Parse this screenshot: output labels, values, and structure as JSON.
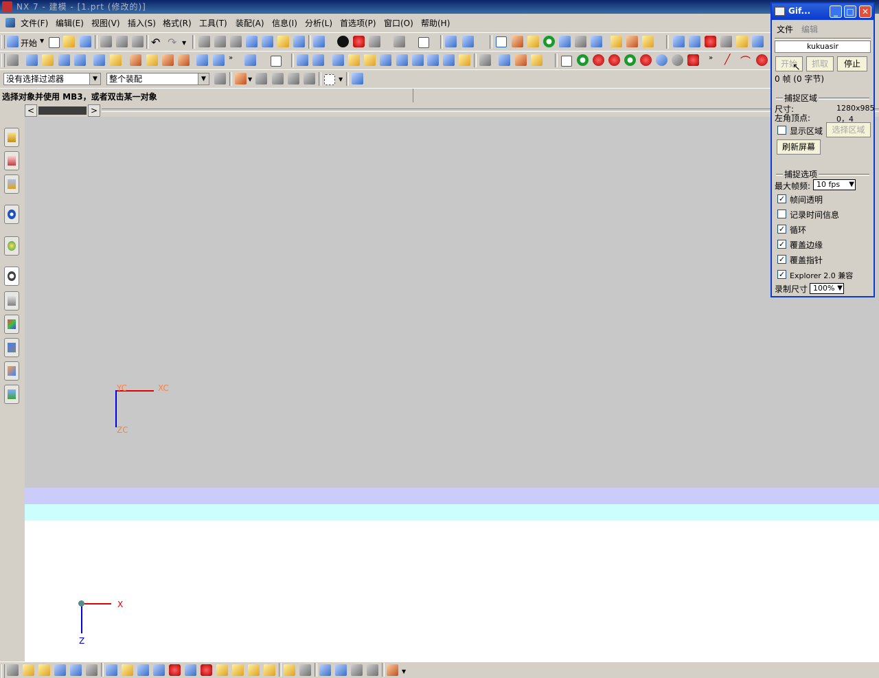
{
  "app": {
    "title": "NX 7 - 建模 - [1.prt (修改的)]"
  },
  "menu": {
    "items": [
      {
        "label": "开始"
      },
      {
        "label": "文件(F)"
      },
      {
        "label": "编辑(E)"
      },
      {
        "label": "视图(V)"
      },
      {
        "label": "插入(S)"
      },
      {
        "label": "格式(R)"
      },
      {
        "label": "工具(T)"
      },
      {
        "label": "装配(A)"
      },
      {
        "label": "信息(I)"
      },
      {
        "label": "分析(L)"
      },
      {
        "label": "首选项(P)"
      },
      {
        "label": "窗口(O)"
      },
      {
        "label": "帮助(H)"
      }
    ]
  },
  "toolbar": {
    "start_label": "开始",
    "filter_value": "没有选择过滤器",
    "scope_value": "整个装配"
  },
  "status": {
    "prompt": "选择对象并使用 MB3，或者双击某一对象"
  },
  "scroll": {
    "left_arrow": "<",
    "right_arrow": ">"
  },
  "axes": {
    "wcs": {
      "x": "XC",
      "y": "YC",
      "z": "ZC"
    },
    "abs": {
      "x": "X",
      "z": "Z"
    }
  },
  "gif": {
    "title": "Gif...",
    "menu_file": "文件",
    "menu_edit": "编辑",
    "author": "kukuasir",
    "start": "开始",
    "grab": "抓取",
    "stop": "停止",
    "frames": "0 帧 (0 字节)",
    "capture_area": "捕捉区域",
    "size_label": "尺寸:",
    "size_value": "1280x985",
    "corner_label": "左角顶点:",
    "corner_value": "0，4",
    "show_area": "显示区域",
    "select_area": "选择区域",
    "refresh": "刷新屏幕",
    "capture_options": "捕捉选项",
    "max_fps_label": "最大帧频:",
    "max_fps_value": "10 fps",
    "opt_transparent": "帧间透明",
    "opt_timeinfo": "记录时间信息",
    "opt_loop": "循环",
    "opt_edge": "覆盖边缘",
    "opt_pointer": "覆盖指针",
    "opt_explorer": "Explorer 2.0 兼容",
    "rec_size_label": "录制尺寸",
    "rec_size_value": "100%"
  }
}
